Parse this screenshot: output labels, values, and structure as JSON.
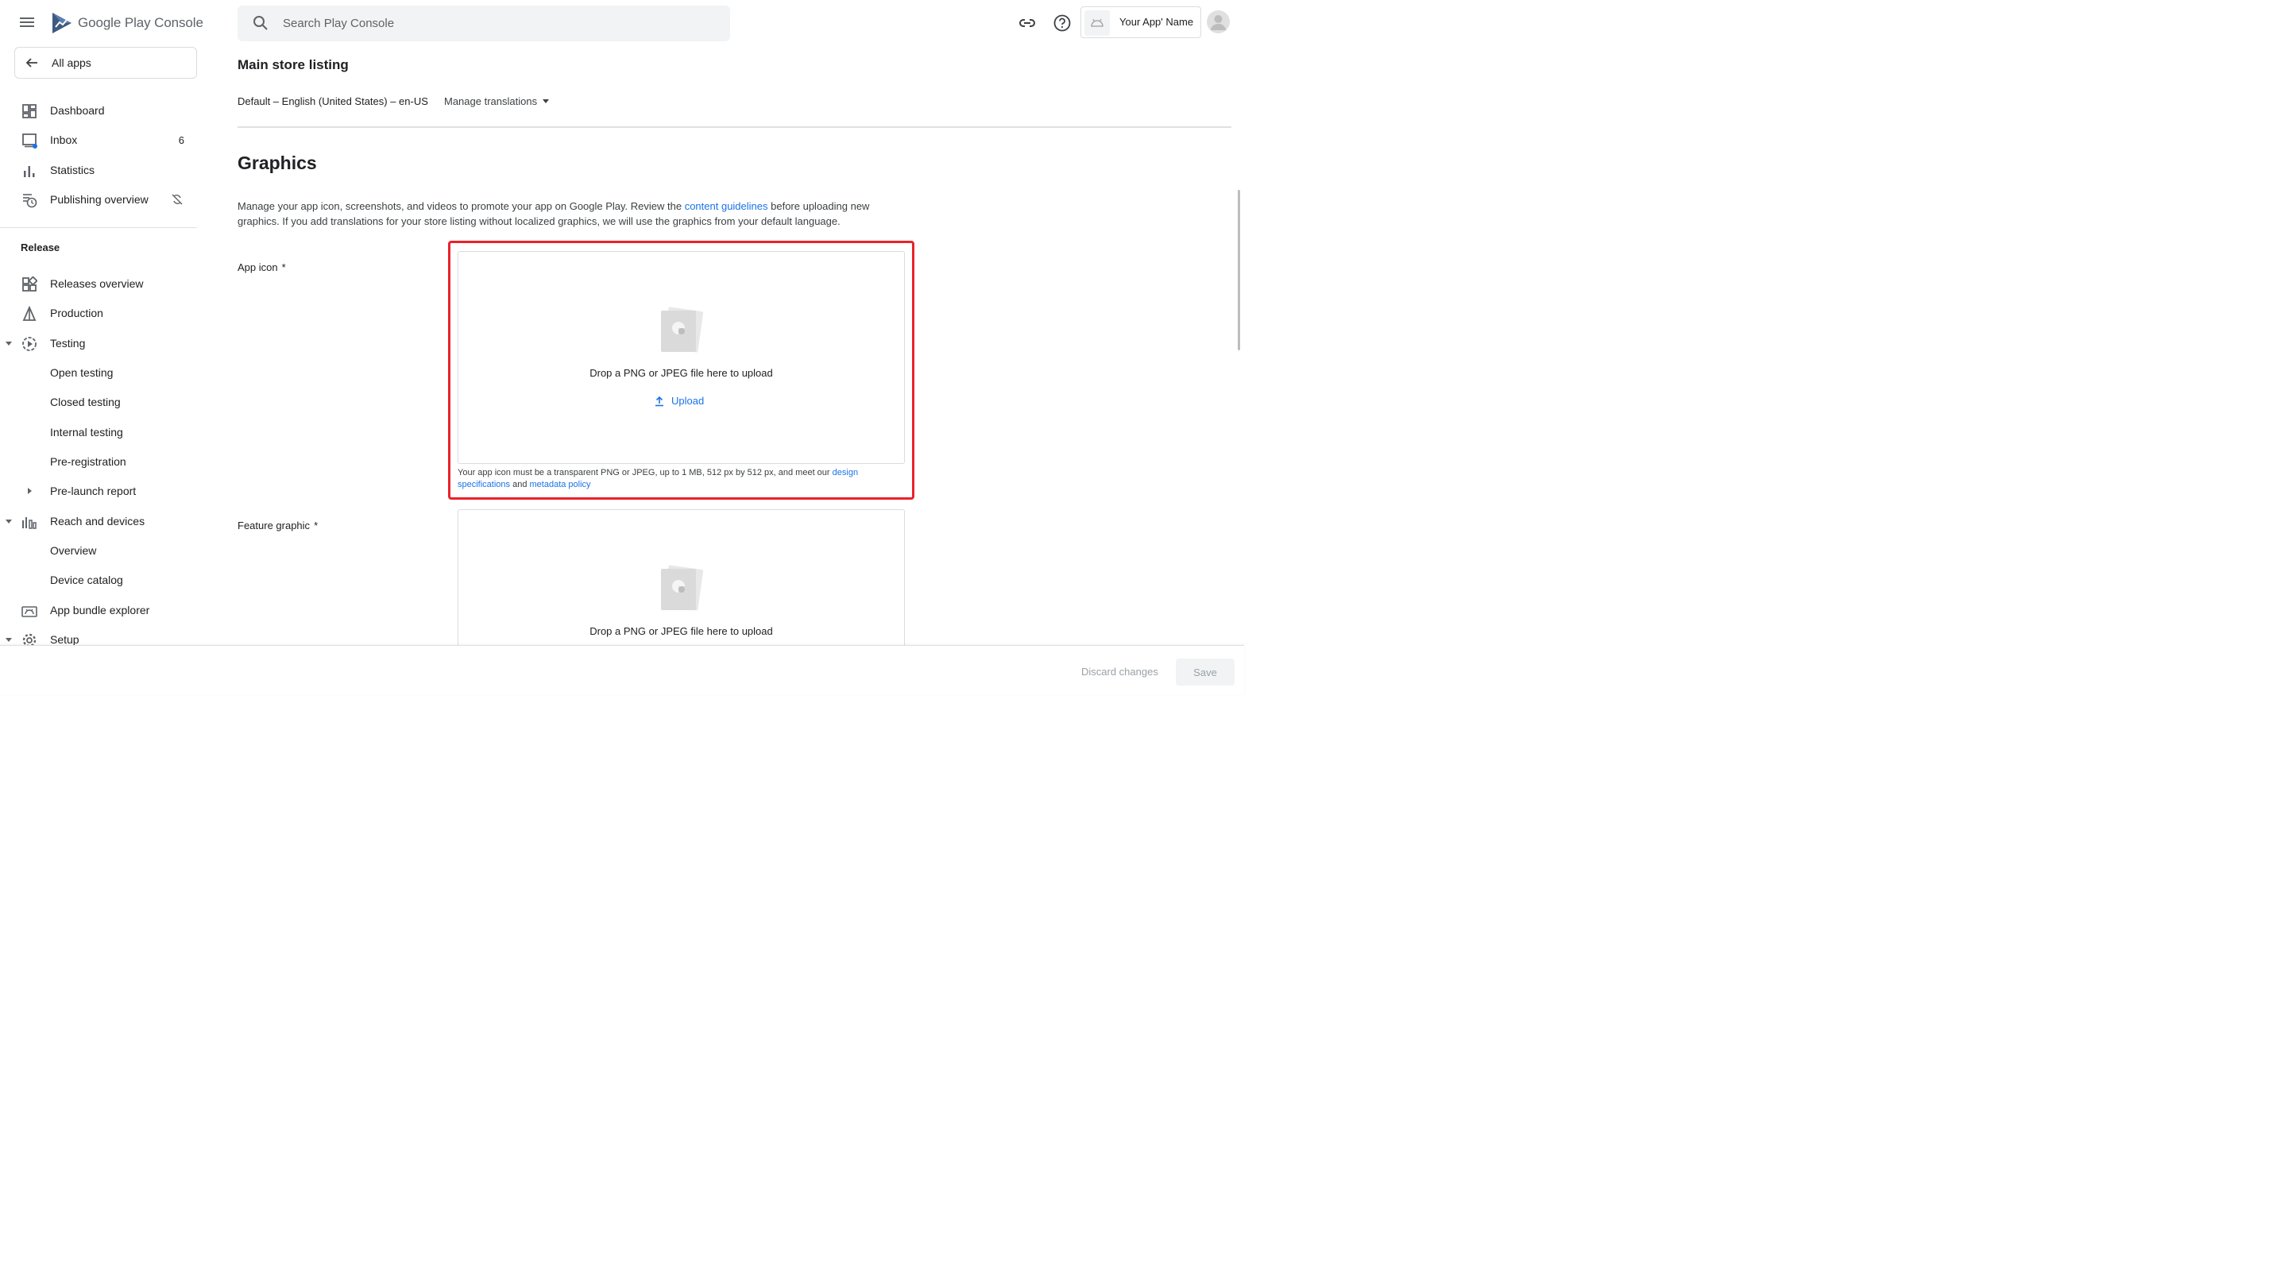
{
  "header": {
    "logo_text_google": "Google Play",
    "logo_text_console": "Console",
    "search_placeholder": "Search Play Console",
    "app_name": "Your App' Name"
  },
  "sidebar": {
    "all_apps": "All apps",
    "items": [
      {
        "label": "Dashboard"
      },
      {
        "label": "Inbox",
        "count": "6"
      },
      {
        "label": "Statistics"
      },
      {
        "label": "Publishing overview"
      }
    ],
    "release_section": "Release",
    "release_items": [
      {
        "label": "Releases overview"
      },
      {
        "label": "Production"
      },
      {
        "label": "Testing"
      },
      {
        "label": "Open testing"
      },
      {
        "label": "Closed testing"
      },
      {
        "label": "Internal testing"
      },
      {
        "label": "Pre-registration"
      },
      {
        "label": "Pre-launch report"
      },
      {
        "label": "Reach and devices"
      },
      {
        "label": "Overview"
      },
      {
        "label": "Device catalog"
      },
      {
        "label": "App bundle explorer"
      },
      {
        "label": "Setup"
      }
    ]
  },
  "main": {
    "title": "Main store listing",
    "language": "Default – English (United States) – en-US",
    "manage_translations": "Manage translations",
    "section_title": "Graphics",
    "description": {
      "before_link": "Manage your app icon, screenshots, and videos to promote your app on Google Play. Review the ",
      "link": "content guidelines",
      "after_link": " before uploading new graphics. If you add translations for your store listing without localized graphics, we will use the graphics from your default language."
    },
    "app_icon": {
      "label": "App icon",
      "required": "*",
      "drop_text": "Drop a PNG or JPEG file here to upload",
      "upload_label": "Upload",
      "hint_before": "Your app icon must be a transparent PNG or JPEG, up to 1 MB, 512 px by 512 px, and meet our ",
      "hint_link1": "design specifications",
      "hint_middle": " and ",
      "hint_link2": "metadata policy"
    },
    "feature_graphic": {
      "label": "Feature graphic",
      "required": "*",
      "drop_text": "Drop a PNG or JPEG file here to upload"
    }
  },
  "footer": {
    "discard_label": "Discard changes",
    "save_label": "Save"
  },
  "colors": {
    "accent": "#1a73e8",
    "highlight": "#e8232a",
    "notification_dot": "#1a73e8"
  }
}
